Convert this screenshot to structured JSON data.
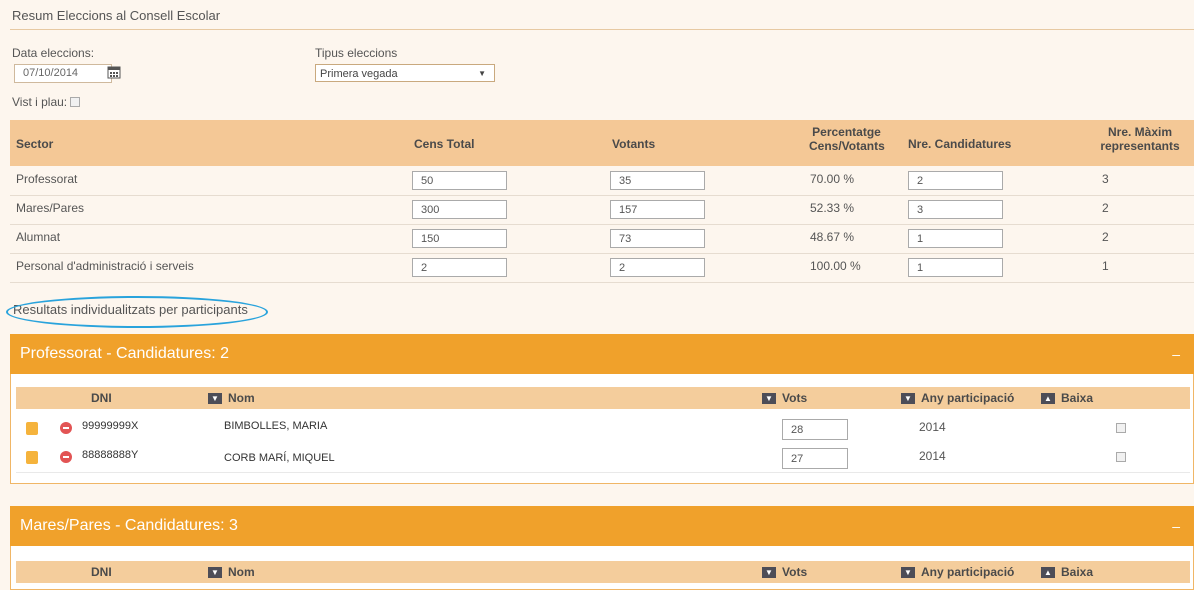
{
  "page_title": "Resum Eleccions al Consell Escolar",
  "form": {
    "date_label": "Data eleccions:",
    "date_value": "07/10/2014",
    "type_label": "Tipus eleccions",
    "type_value": "Primera vegada",
    "approve_label": "Vist i plau:"
  },
  "summary": {
    "headers": {
      "sector": "Sector",
      "cens": "Cens Total",
      "votants": "Votants",
      "pct_1": "Percentatge",
      "pct_2": "Cens/Votants",
      "cand": "Nre. Candidatures",
      "max_1": "Nre. Màxim",
      "max_2": "representants"
    },
    "rows": [
      {
        "sector": "Professorat",
        "cens": "50",
        "votants": "35",
        "pct": "70.00 %",
        "cand": "2",
        "max": "3"
      },
      {
        "sector": "Mares/Pares",
        "cens": "300",
        "votants": "157",
        "pct": "52.33 %",
        "cand": "3",
        "max": "2"
      },
      {
        "sector": "Alumnat",
        "cens": "150",
        "votants": "73",
        "pct": "48.67 %",
        "cand": "1",
        "max": "2"
      },
      {
        "sector": "Personal d'administració i serveis",
        "cens": "2",
        "votants": "2",
        "pct": "100.00 %",
        "cand": "1",
        "max": "1"
      }
    ]
  },
  "results_title": "Resultats individualitzats per participants",
  "panels": [
    {
      "title": "Professorat - Candidatures: 2",
      "minimize": "–",
      "cols": {
        "dni": "DNI",
        "nom": "Nom",
        "vots": "Vots",
        "any": "Any participació",
        "baixa": "Baixa"
      },
      "rows": [
        {
          "dni": "99999999X",
          "nom": "BIMBOLLES, MARIA",
          "vots": "28",
          "any": "2014"
        },
        {
          "dni": "88888888Y",
          "nom": "CORB MARÍ, MIQUEL",
          "vots": "27",
          "any": "2014"
        }
      ]
    },
    {
      "title": "Mares/Pares - Candidatures: 3",
      "minimize": "–",
      "cols": {
        "dni": "DNI",
        "nom": "Nom",
        "vots": "Vots",
        "any": "Any participació",
        "baixa": "Baixa"
      }
    }
  ],
  "icons": {
    "sort_down": "▼",
    "sort_up": "▲",
    "calendar": "calendar-icon",
    "select_arrow": "▼"
  },
  "colors": {
    "section": "#f0a12b",
    "table_header": "#f4c896",
    "subheader": "#f4cd9c",
    "highlight": "#29a3dc"
  }
}
